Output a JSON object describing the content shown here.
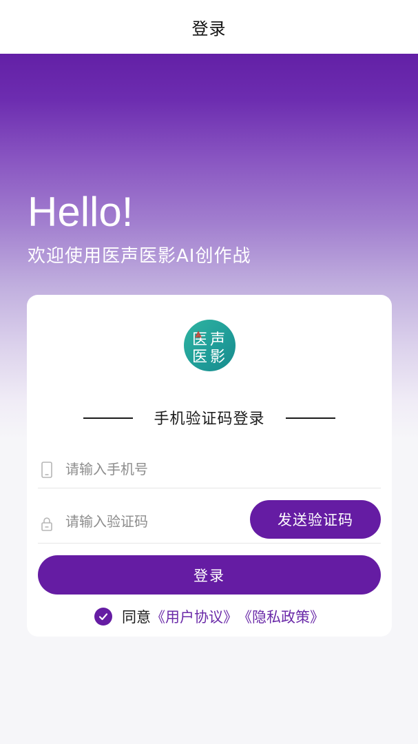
{
  "navbar": {
    "title": "登录"
  },
  "hero": {
    "greeting": "Hello!",
    "subtitle": "欢迎使用医声医影AI创作战"
  },
  "card": {
    "logo": {
      "icon": "app-logo-icon",
      "line1_left": "医",
      "line1_right": "声",
      "line2_left": "医",
      "line2_right": "影"
    },
    "section_title": "手机验证码登录",
    "phone_field": {
      "icon": "phone-icon",
      "placeholder": "请输入手机号",
      "value": ""
    },
    "code_field": {
      "icon": "lock-icon",
      "placeholder": "请输入验证码",
      "value": ""
    },
    "send_code_label": "发送验证码",
    "login_label": "登录",
    "agreement": {
      "checked": true,
      "prefix": "同意",
      "user_agreement": "《用户协议》",
      "privacy_policy": "《隐私政策》"
    }
  },
  "colors": {
    "primary": "#651ca3",
    "hero_top": "#6320a6",
    "page_background": "#f6f6f9",
    "logo_teal": "#1f9c98"
  }
}
